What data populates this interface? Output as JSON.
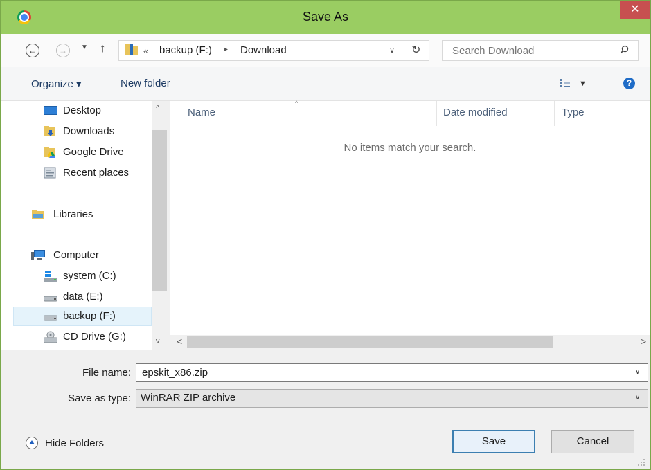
{
  "window": {
    "title": "Save As",
    "close_glyph": "✕",
    "app_icon": "chrome-icon"
  },
  "nav": {
    "back_glyph": "←",
    "forward_glyph": "→",
    "recent_glyph": "▼",
    "up_glyph": "↑",
    "address": {
      "overflow_glyph": "«",
      "crumbs": [
        "backup (F:)",
        "Download"
      ],
      "separator_glyph": "▸",
      "dropdown_glyph": "∨",
      "refresh_glyph": "↻"
    },
    "search": {
      "placeholder": "Search Download"
    }
  },
  "toolbar": {
    "organize_label": "Organize ▾",
    "new_folder_label": "New folder",
    "views_dropdown_glyph": "▼",
    "help_glyph": "?"
  },
  "sidebar": {
    "scroll_up_glyph": "^",
    "scroll_down_glyph": "v",
    "items": [
      {
        "label": "Desktop",
        "icon": "desktop-icon"
      },
      {
        "label": "Downloads",
        "icon": "downloads-folder-icon"
      },
      {
        "label": "Google Drive",
        "icon": "google-drive-folder-icon"
      },
      {
        "label": "Recent places",
        "icon": "recent-places-icon"
      },
      {
        "label": "Libraries",
        "icon": "libraries-icon"
      },
      {
        "label": "Computer",
        "icon": "computer-icon"
      },
      {
        "label": "system (C:)",
        "icon": "system-drive-icon"
      },
      {
        "label": "data (E:)",
        "icon": "drive-icon"
      },
      {
        "label": "backup (F:)",
        "icon": "drive-icon",
        "selected": true
      },
      {
        "label": "CD Drive (G:)",
        "icon": "cd-drive-icon"
      }
    ]
  },
  "file_list": {
    "columns": [
      "Name",
      "Date modified",
      "Type"
    ],
    "sort_glyph": "^",
    "empty_message": "No items match your search.",
    "scroll_left_glyph": "<",
    "scroll_right_glyph": ">"
  },
  "form": {
    "file_name_label": "File name:",
    "file_name_value": "epskit_x86.zip",
    "save_as_type_label": "Save as type:",
    "save_as_type_value": "WinRAR ZIP archive",
    "dropdown_glyph": "∨"
  },
  "footer": {
    "hide_folders_label": "Hide Folders",
    "save_label": "Save",
    "cancel_label": "Cancel"
  },
  "colors": {
    "titlebar": "#9acd62",
    "close_button": "#c75050",
    "selection": "#e5f3fb",
    "default_button_border": "#3c7fb1"
  }
}
